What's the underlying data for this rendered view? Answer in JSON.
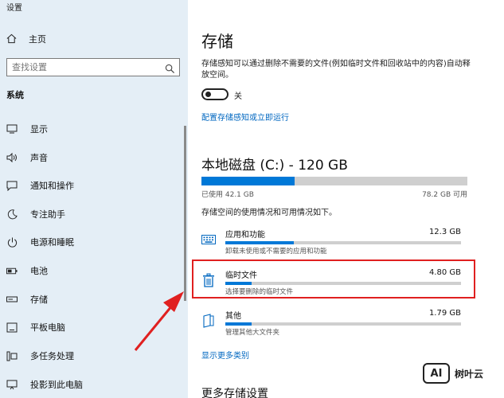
{
  "window": {
    "title": "设置"
  },
  "sidebar": {
    "home_label": "主页",
    "search_placeholder": "查找设置",
    "section_title": "系统",
    "items": [
      {
        "label": "显示",
        "icon": "monitor-icon"
      },
      {
        "label": "声音",
        "icon": "speaker-icon"
      },
      {
        "label": "通知和操作",
        "icon": "notification-icon"
      },
      {
        "label": "专注助手",
        "icon": "moon-icon"
      },
      {
        "label": "电源和睡眠",
        "icon": "power-icon"
      },
      {
        "label": "电池",
        "icon": "battery-icon"
      },
      {
        "label": "存储",
        "icon": "storage-icon"
      },
      {
        "label": "平板电脑",
        "icon": "tablet-icon"
      },
      {
        "label": "多任务处理",
        "icon": "multitask-icon"
      },
      {
        "label": "投影到此电脑",
        "icon": "project-icon"
      }
    ]
  },
  "main": {
    "title": "存储",
    "description": "存储感知可以通过删除不需要的文件(例如临时文件和回收站中的内容)自动释放空间。",
    "toggle_state_label": "关",
    "toggle_on": false,
    "configure_link": "配置存储感知或立即运行",
    "disk_title": "本地磁盘 (C:) - 120 GB",
    "disk_used_label": "已使用 42.1 GB",
    "disk_free_label": "78.2 GB 可用",
    "disk_used_fraction": 0.351,
    "usage_desc": "存储空间的使用情况和可用情况如下。",
    "categories": [
      {
        "name": "应用和功能",
        "size": "12.3 GB",
        "sub": "卸载未使用或不需要的应用和功能",
        "fraction": 0.29,
        "icon": "keyboard-icon"
      },
      {
        "name": "临时文件",
        "size": "4.80 GB",
        "sub": "选择要删除的临时文件",
        "fraction": 0.11,
        "icon": "trash-icon"
      },
      {
        "name": "其他",
        "size": "1.79 GB",
        "sub": "管理其他大文件夹",
        "fraction": 0.11,
        "icon": "folder-icon"
      }
    ],
    "show_more_link": "显示更多类别",
    "more_settings_title": "更多存储设置"
  },
  "watermark": {
    "logo": "AI",
    "text": "树叶云"
  },
  "colors": {
    "accent": "#0078d7",
    "link": "#0067c0",
    "sidebar_bg": "#e4eef6",
    "highlight": "#e02020"
  }
}
